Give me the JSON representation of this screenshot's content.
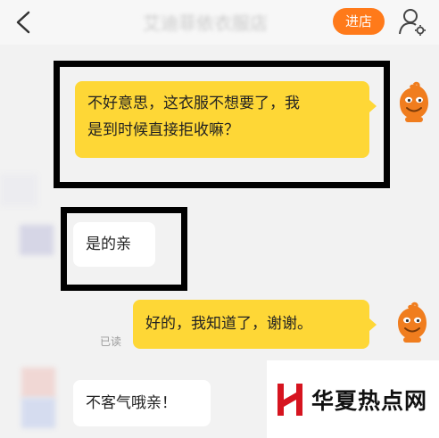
{
  "header": {
    "title": "艾迪菲依衣服店",
    "shop_button": "进店"
  },
  "messages": [
    {
      "side": "right",
      "text1": "不好意思，这衣服不想要了，我",
      "text2": "是到时候直接拒收嘛？"
    },
    {
      "side": "left",
      "text": "是的亲"
    },
    {
      "side": "right",
      "text": "好的，我知道了，谢谢。",
      "status": "已读"
    },
    {
      "side": "left",
      "text": "不客气哦亲！"
    }
  ],
  "watermark": {
    "text": "华夏热点网"
  },
  "colors": {
    "accent_orange": "#ff7a1a",
    "bubble_yellow": "#fed736",
    "background": "#f2f2f2"
  },
  "icons": [
    "back-arrow-icon",
    "user-settings-icon",
    "orange-avatar-icon",
    "watermark-logo-icon"
  ]
}
